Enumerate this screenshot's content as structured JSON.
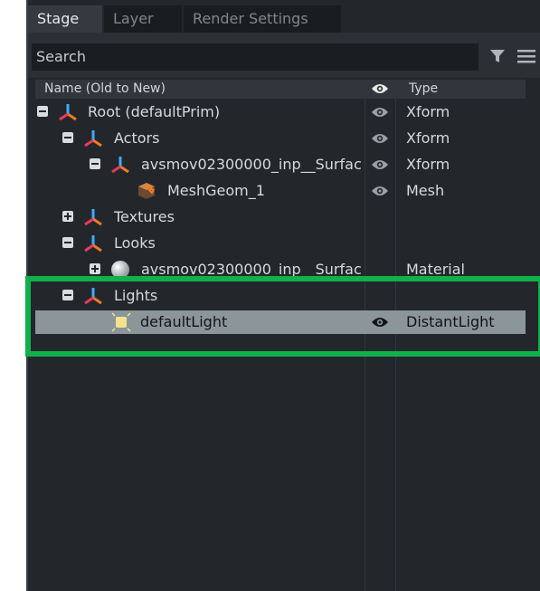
{
  "tabs": [
    {
      "label": "Stage",
      "active": true
    },
    {
      "label": "Layer",
      "active": false
    },
    {
      "label": "Render Settings",
      "active": false
    }
  ],
  "search": {
    "placeholder": "Search"
  },
  "header": {
    "name": "Name (Old to New)",
    "type": "Type"
  },
  "rows": [
    {
      "label": "Root (defaultPrim)",
      "type": "Xform"
    },
    {
      "label": "Actors",
      "type": "Xform"
    },
    {
      "label": "avsmov02300000_inp__Surfac",
      "type": "Xform"
    },
    {
      "label": "MeshGeom_1",
      "type": "Mesh"
    },
    {
      "label": "Textures",
      "type": ""
    },
    {
      "label": "Looks",
      "type": ""
    },
    {
      "label": "avsmov02300000_inp__Surfac",
      "type": "Material"
    },
    {
      "label": "Lights",
      "type": ""
    },
    {
      "label": "defaultLight",
      "type": "DistantLight"
    }
  ],
  "colors": {
    "selection": "#8c9599",
    "highlight": "#10b04a"
  }
}
